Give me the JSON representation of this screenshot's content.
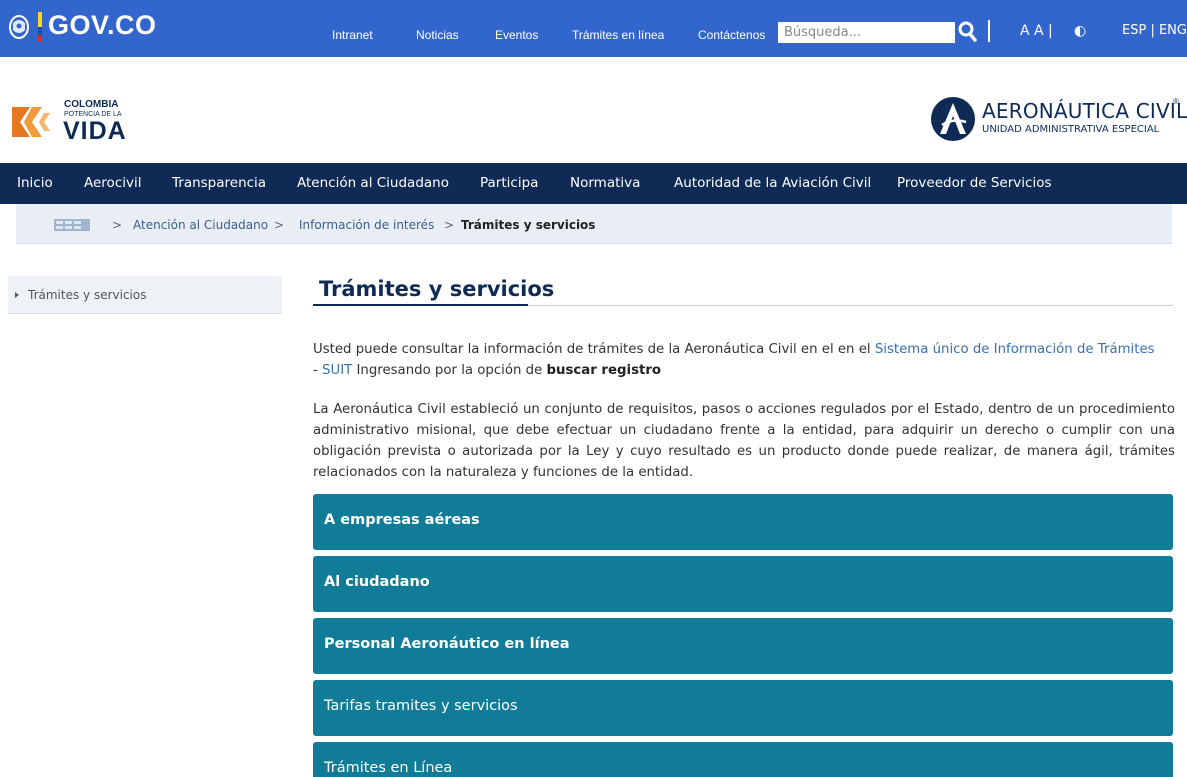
{
  "govbar": {
    "logo": "GOV.CO",
    "nav": [
      {
        "label": "Intranet"
      },
      {
        "label": "Noticias"
      },
      {
        "label": "Eventos"
      },
      {
        "label": "Trámites en línea"
      },
      {
        "label": "Contáctenos"
      }
    ],
    "search_placeholder": "Búsqueda...",
    "font_size_label": "A A |",
    "contrast_label": "◐",
    "language_label": "ESP | ENG"
  },
  "brand": {
    "left_line1": "COLOMBIA",
    "left_line2": "POTENCIA DE LA",
    "left_line3": "VIDA",
    "right_title": "AERONÁUTICA CIVIL",
    "right_subtitle": "UNIDAD ADMINISTRATIVA ESPECIAL",
    "right_reg": "®"
  },
  "mainnav": [
    {
      "label": "Inicio"
    },
    {
      "label": "Aerocivil"
    },
    {
      "label": "Transparencia"
    },
    {
      "label": "Atención al Ciudadano"
    },
    {
      "label": "Participa"
    },
    {
      "label": "Normativa"
    },
    {
      "label": "Autoridad de la Aviación Civil"
    },
    {
      "label": "Proveedor de Servicios"
    }
  ],
  "breadcrumb": {
    "separator": ">",
    "items": [
      {
        "label": "Atención al Ciudadano"
      },
      {
        "label": "Información de interés"
      },
      {
        "label": "Trámites y servicios"
      }
    ]
  },
  "sidebar": {
    "items": [
      {
        "label": "Trámites y servicios"
      }
    ]
  },
  "content": {
    "title": "Trámites y servicios",
    "para1_a": "Usted puede consultar la información de trámites de la Aeronáutica Civil en el en el ",
    "para1_link": "Sistema único de Información de Trámites",
    "para1_b": "- ",
    "para1_link2": "SUIT",
    "para1_c": " Ingresando por la opción de ",
    "para1_strong": "buscar registro",
    "para2": "La Aeronáutica Civil estableció un conjunto de requisitos, pasos o acciones regulados por el Estado, dentro de un procedimiento administrativo misional, que debe efectuar un ciudadano frente a la entidad, para adquirir un derecho o cumplir con una obligación prevista o autorizada por la Ley y cuyo resultado es un producto donde puede realizar, de manera ágil, trámites relacionados con la naturaleza y funciones de la entidad.",
    "accordions": [
      {
        "label": "A empresas aéreas"
      },
      {
        "label": "Al ciudadano"
      },
      {
        "label": "Personal Aeronáutico en línea"
      },
      {
        "label": "Tarifas tramites y servicios"
      },
      {
        "label": "Trámites en Línea"
      }
    ]
  },
  "colors": {
    "gov_blue": "#3366cc",
    "navy": "#0e2a55",
    "teal": "#117c97"
  }
}
